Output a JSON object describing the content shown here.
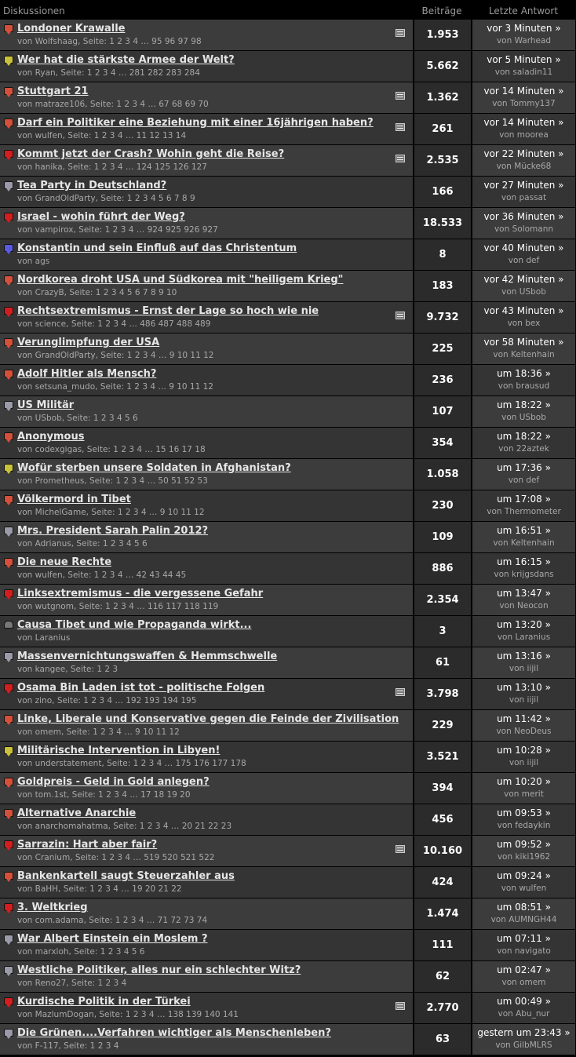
{
  "header": {
    "topic": "Diskussionen",
    "posts": "Beiträge",
    "last": "Letzte Antwort"
  },
  "colors": {
    "hot": "#d4503a",
    "fire": "#d21e1e",
    "new": "#c8c23a",
    "normal": "#9a9aa8",
    "locked": "#777777",
    "poll": "#5a5ae0"
  },
  "threads": [
    {
      "icon": "hot",
      "title": "Londoner Krawalle",
      "meta": "von Wolfshaag, Seite: 1 2 3 4 … 95 96 97 98",
      "posts": "1.953",
      "time": "vor 3 Minuten »",
      "by": "von Warhead",
      "flag": true
    },
    {
      "icon": "new",
      "title": "Wer hat die stärkste Armee der Welt?",
      "meta": "von Ryan, Seite: 1 2 3 4 … 281 282 283 284",
      "posts": "5.662",
      "time": "vor 5 Minuten »",
      "by": "von saladin11",
      "flag": false
    },
    {
      "icon": "hot",
      "title": "Stuttgart 21",
      "meta": "von matraze106, Seite: 1 2 3 4 … 67 68 69 70",
      "posts": "1.362",
      "time": "vor 14 Minuten »",
      "by": "von Tommy137",
      "flag": true
    },
    {
      "icon": "hot",
      "title": "Darf ein Politiker eine Beziehung mit einer 16jährigen haben?",
      "meta": "von wulfen, Seite: 1 2 3 4 … 11 12 13 14",
      "posts": "261",
      "time": "vor 14 Minuten »",
      "by": "von moorea",
      "flag": true
    },
    {
      "icon": "fire",
      "title": "Kommt jetzt der Crash? Wohin geht die Reise?",
      "meta": "von hanika, Seite: 1 2 3 4 … 124 125 126 127",
      "posts": "2.535",
      "time": "vor 22 Minuten »",
      "by": "von Mücke68",
      "flag": true
    },
    {
      "icon": "normal",
      "title": "Tea Party in Deutschland?",
      "meta": "von GrandOldParty, Seite: 1 2 3 4 5 6 7 8 9",
      "posts": "166",
      "time": "vor 27 Minuten »",
      "by": "von passat",
      "flag": false
    },
    {
      "icon": "fire",
      "title": "Israel - wohin führt der Weg?",
      "meta": "von vampirox, Seite: 1 2 3 4 … 924 925 926 927",
      "posts": "18.533",
      "time": "vor 36 Minuten »",
      "by": "von Solomann",
      "flag": false
    },
    {
      "icon": "poll",
      "title": "Konstantin und sein Einfluß auf das Christentum",
      "meta": "von ags",
      "posts": "8",
      "time": "vor 40 Minuten »",
      "by": "von def",
      "flag": false
    },
    {
      "icon": "hot",
      "title": "Nordkorea droht USA und Südkorea mit \"heiligem Krieg\"",
      "meta": "von CrazyB, Seite: 1 2 3 4 5 6 7 8 9 10",
      "posts": "183",
      "time": "vor 42 Minuten »",
      "by": "von USbob",
      "flag": false
    },
    {
      "icon": "fire",
      "title": "Rechtsextremismus - Ernst der Lage so hoch wie nie",
      "meta": "von science, Seite: 1 2 3 4 … 486 487 488 489",
      "posts": "9.732",
      "time": "vor 43 Minuten »",
      "by": "von bex",
      "flag": true
    },
    {
      "icon": "hot",
      "title": "Verunglimpfung der USA",
      "meta": "von GrandOldParty, Seite: 1 2 3 4 … 9 10 11 12",
      "posts": "225",
      "time": "vor 58 Minuten »",
      "by": "von Keltenhain",
      "flag": false
    },
    {
      "icon": "hot",
      "title": "Adolf Hitler als Mensch?",
      "meta": "von setsuna_mudo, Seite: 1 2 3 4 … 9 10 11 12",
      "posts": "236",
      "time": "um 18:36 »",
      "by": "von brausud",
      "flag": false
    },
    {
      "icon": "normal",
      "title": "US Militär",
      "meta": "von USbob, Seite: 1 2 3 4 5 6",
      "posts": "107",
      "time": "um 18:22 »",
      "by": "von USbob",
      "flag": false
    },
    {
      "icon": "hot",
      "title": "Anonymous",
      "meta": "von codexgigas, Seite: 1 2 3 4 … 15 16 17 18",
      "posts": "354",
      "time": "um 18:22 »",
      "by": "von 22aztek",
      "flag": false
    },
    {
      "icon": "new",
      "title": "Wofür sterben unsere Soldaten in Afghanistan?",
      "meta": "von Prometheus, Seite: 1 2 3 4 … 50 51 52 53",
      "posts": "1.058",
      "time": "um 17:36 »",
      "by": "von def",
      "flag": false
    },
    {
      "icon": "hot",
      "title": "Völkermord in Tibet",
      "meta": "von MichelGame, Seite: 1 2 3 4 … 9 10 11 12",
      "posts": "230",
      "time": "um 17:08 »",
      "by": "von Thermometer",
      "flag": false
    },
    {
      "icon": "normal",
      "title": "Mrs. President Sarah Palin 2012?",
      "meta": "von Adrianus, Seite: 1 2 3 4 5 6",
      "posts": "109",
      "time": "um 16:51 »",
      "by": "von Keltenhain",
      "flag": false
    },
    {
      "icon": "hot",
      "title": "Die neue Rechte",
      "meta": "von wulfen, Seite: 1 2 3 4 … 42 43 44 45",
      "posts": "886",
      "time": "um 16:15 »",
      "by": "von krijgsdans",
      "flag": false
    },
    {
      "icon": "fire",
      "title": "Linksextremismus - die vergessene Gefahr",
      "meta": "von wutgnom, Seite: 1 2 3 4 … 116 117 118 119",
      "posts": "2.354",
      "time": "um 13:47 »",
      "by": "von Neocon",
      "flag": false
    },
    {
      "icon": "locked",
      "title": "Causa Tibet und wie Propaganda wirkt...",
      "meta": "von Laranius",
      "posts": "3",
      "time": "um 13:20 »",
      "by": "von Laranius",
      "flag": false
    },
    {
      "icon": "normal",
      "title": "Massenvernichtungswaffen & Hemmschwelle",
      "meta": "von kangee, Seite: 1 2 3",
      "posts": "61",
      "time": "um 13:16 »",
      "by": "von iijil",
      "flag": false
    },
    {
      "icon": "fire",
      "title": "Osama Bin Laden ist tot - politische Folgen",
      "meta": "von zino, Seite: 1 2 3 4 … 192 193 194 195",
      "posts": "3.798",
      "time": "um 13:10 »",
      "by": "von iijil",
      "flag": true
    },
    {
      "icon": "hot",
      "title": "Linke, Liberale und Konservative gegen die Feinde der Zivilisation",
      "meta": "von omem, Seite: 1 2 3 4 … 9 10 11 12",
      "posts": "229",
      "time": "um 11:42 »",
      "by": "von NeoDeus",
      "flag": false
    },
    {
      "icon": "new",
      "title": "Militärische Intervention in Libyen!",
      "meta": "von understatement, Seite: 1 2 3 4 … 175 176 177 178",
      "posts": "3.521",
      "time": "um 10:28 »",
      "by": "von iijil",
      "flag": false
    },
    {
      "icon": "hot",
      "title": "Goldpreis - Geld in Gold anlegen?",
      "meta": "von tom.1st, Seite: 1 2 3 4 … 17 18 19 20",
      "posts": "394",
      "time": "um 10:20 »",
      "by": "von merit",
      "flag": false
    },
    {
      "icon": "hot",
      "title": "Alternative Anarchie",
      "meta": "von anarchomahatma, Seite: 1 2 3 4 … 20 21 22 23",
      "posts": "456",
      "time": "um 09:53 »",
      "by": "von fedaykin",
      "flag": false
    },
    {
      "icon": "fire",
      "title": "Sarrazin: Hart aber fair?",
      "meta": "von Cranium, Seite: 1 2 3 4 … 519 520 521 522",
      "posts": "10.160",
      "time": "um 09:52 »",
      "by": "von kiki1962",
      "flag": true
    },
    {
      "icon": "hot",
      "title": "Bankenkartell saugt Steuerzahler aus",
      "meta": "von BaHH, Seite: 1 2 3 4 … 19 20 21 22",
      "posts": "424",
      "time": "um 09:24 »",
      "by": "von wulfen",
      "flag": false
    },
    {
      "icon": "fire",
      "title": "3. Weltkrieg",
      "meta": "von com.adama, Seite: 1 2 3 4 … 71 72 73 74",
      "posts": "1.474",
      "time": "um 08:51 »",
      "by": "von AUMNGH44",
      "flag": false
    },
    {
      "icon": "normal",
      "title": "War Albert Einstein ein Moslem ?",
      "meta": "von marxloh, Seite: 1 2 3 4 5 6",
      "posts": "111",
      "time": "um 07:11 »",
      "by": "von navigato",
      "flag": false
    },
    {
      "icon": "normal",
      "title": "Westliche Politiker, alles nur ein schlechter Witz?",
      "meta": "von Reno27, Seite: 1 2 3 4",
      "posts": "62",
      "time": "um 02:47 »",
      "by": "von omem",
      "flag": false
    },
    {
      "icon": "fire",
      "title": "Kurdische Politik in der Türkei",
      "meta": "von MazlumDogan, Seite: 1 2 3 4 … 138 139 140 141",
      "posts": "2.770",
      "time": "um 00:49 »",
      "by": "von Abu_nur",
      "flag": true
    },
    {
      "icon": "normal",
      "title": "Die Grünen....Verfahren wichtiger als Menschenleben?",
      "meta": "von F-117, Seite: 1 2 3 4",
      "posts": "63",
      "time": "gestern um 23:43 »",
      "by": "von GilbMLRS",
      "flag": false
    }
  ]
}
